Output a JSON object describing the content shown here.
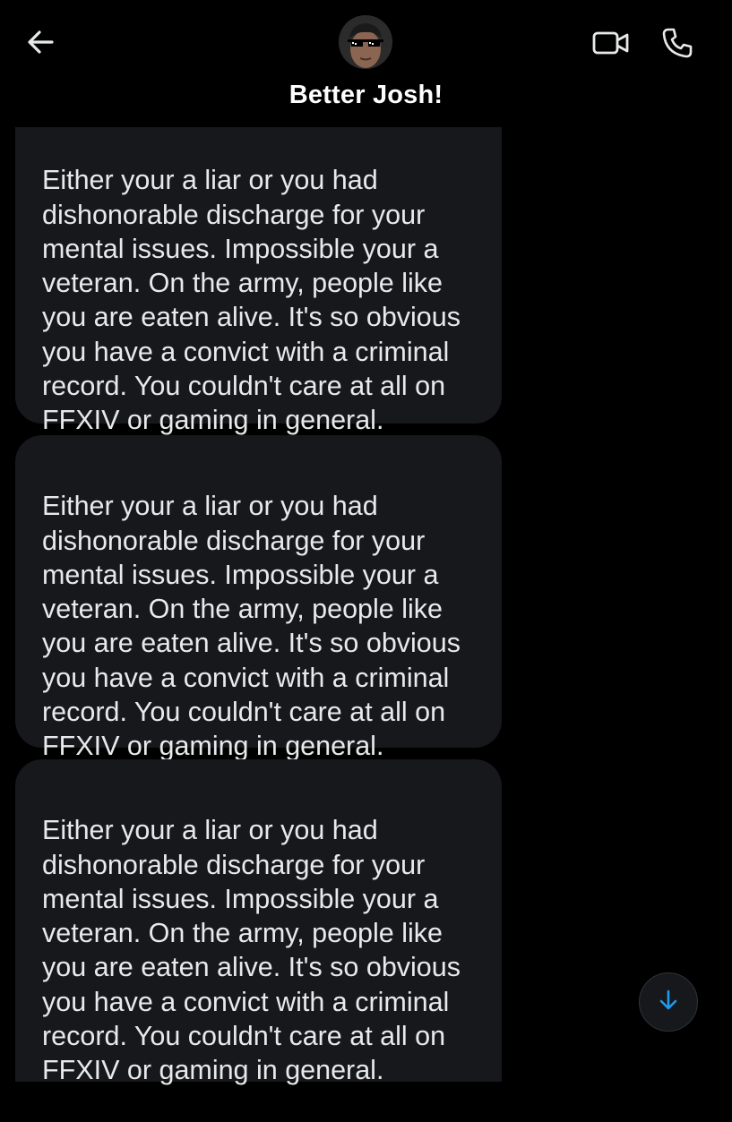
{
  "header": {
    "contact_name": "Better Josh!",
    "icons": {
      "back": "arrow-left-icon",
      "video": "video-camera-icon",
      "phone": "phone-icon"
    }
  },
  "messages": [
    {
      "text": "Either your a liar or you had\ndishonorable discharge for your\nmental issues. Impossible your a\nveteran. On the army, people like\nyou are eaten alive. It's so obvious\nyou have a convict with a criminal\nrecord. You couldn't care at all on\nFFXIV or gaming in general."
    },
    {
      "text": "Either your a liar or you had\ndishonorable discharge for your\nmental issues. Impossible your a\nveteran. On the army, people like\nyou are eaten alive. It's so obvious\nyou have a convict with a criminal\nrecord. You couldn't care at all on\nFFXIV or gaming in general."
    },
    {
      "text": "Either your a liar or you had\ndishonorable discharge for your\nmental issues. Impossible your a\nveteran. On the army, people like\nyou are eaten alive. It's so obvious\nyou have a convict with a criminal\nrecord. You couldn't care at all on\nFFXIV or gaming in general."
    }
  ],
  "scroll_button": {
    "icon": "arrow-down-icon"
  },
  "colors": {
    "background": "#000000",
    "bubble": "#16181c",
    "text": "#e7e9ea",
    "accent": "#1d9bf0"
  }
}
